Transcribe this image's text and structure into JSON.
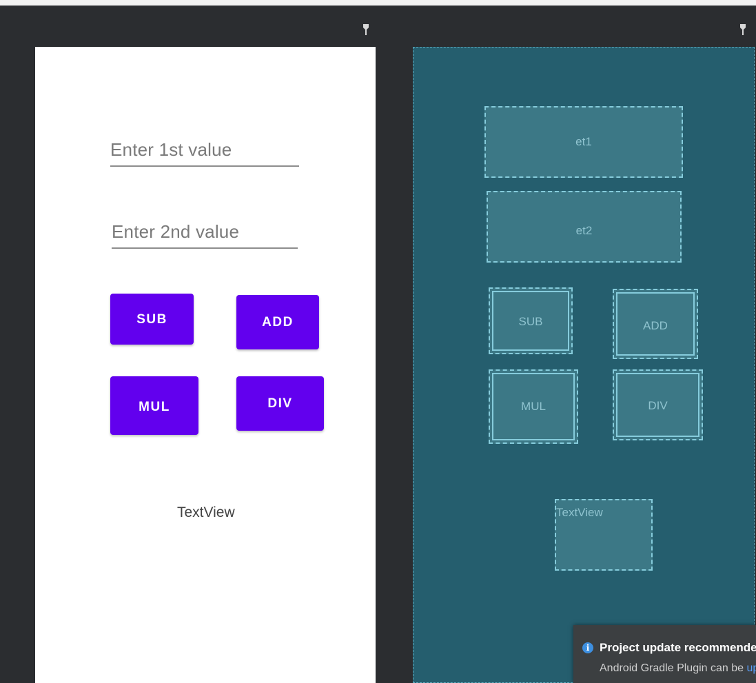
{
  "design": {
    "field1_hint": "Enter 1st value",
    "field2_hint": "Enter 2nd value",
    "buttons": {
      "sub": "SUB",
      "add": "ADD",
      "mul": "MUL",
      "div": "DIV"
    },
    "textview": "TextView",
    "accent_color": "#6200ee"
  },
  "blueprint": {
    "et1": "et1",
    "et2": "et2",
    "sub": "SUB",
    "add": "ADD",
    "mul": "MUL",
    "div": "DIV",
    "textview": "TextView"
  },
  "icons": {
    "design_pin": "pin-icon",
    "blueprint_pin": "pin-icon",
    "info": "info-icon"
  },
  "notification": {
    "title": "Project update recommended",
    "body": "Android Gradle Plugin can be ",
    "link": "upgraded"
  }
}
